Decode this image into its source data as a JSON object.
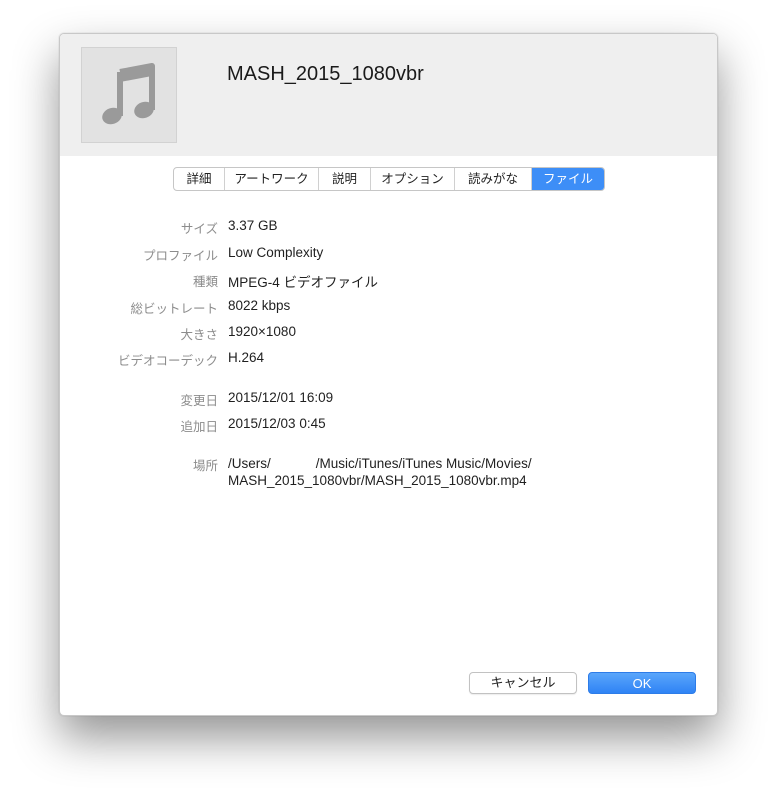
{
  "dialog": {
    "title": "MASH_2015_1080vbr"
  },
  "tabs": [
    {
      "label": "詳細",
      "active": false
    },
    {
      "label": "アートワーク",
      "active": false
    },
    {
      "label": "説明",
      "active": false
    },
    {
      "label": "オプション",
      "active": false
    },
    {
      "label": "読みがな",
      "active": false
    },
    {
      "label": "ファイル",
      "active": true
    }
  ],
  "file_info": {
    "size": {
      "label": "サイズ",
      "value": "3.37 GB"
    },
    "profile": {
      "label": "プロファイル",
      "value": "Low Complexity"
    },
    "kind": {
      "label": "種類",
      "value": "MPEG-4 ビデオファイル"
    },
    "bitrate": {
      "label": "総ビットレート",
      "value": "8022 kbps"
    },
    "dimensions": {
      "label": "大きさ",
      "value": "1920×1080"
    },
    "codec": {
      "label": "ビデオコーデック",
      "value": "H.264"
    },
    "modified": {
      "label": "変更日",
      "value": "2015/12/01 16:09"
    },
    "added": {
      "label": "追加日",
      "value": "2015/12/03 0:45"
    },
    "location": {
      "label": "場所",
      "line1": "/Users/            /Music/iTunes/iTunes Music/Movies/",
      "line2": "MASH_2015_1080vbr/MASH_2015_1080vbr.mp4"
    }
  },
  "buttons": {
    "cancel": "キャンセル",
    "ok": "OK"
  },
  "colors": {
    "accent": "#3d8ef7",
    "header_bg": "#efefef",
    "label_gray": "#8c8c8c"
  },
  "icons": {
    "artwork": "music-note-icon"
  }
}
